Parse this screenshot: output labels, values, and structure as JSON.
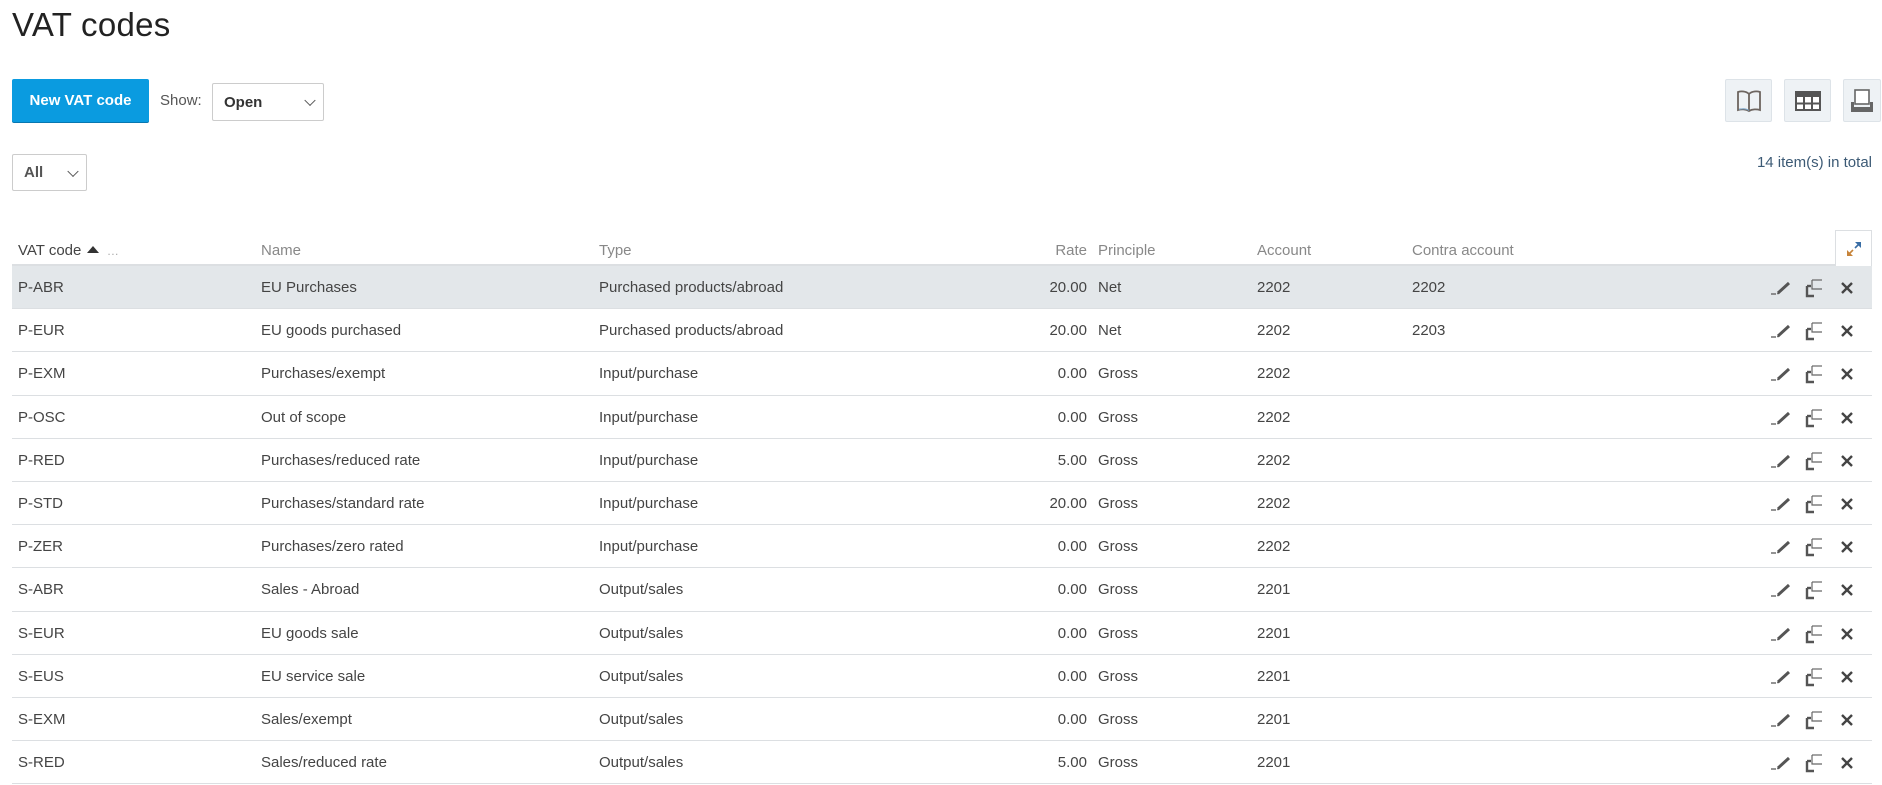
{
  "page": {
    "title": "VAT codes"
  },
  "toolbar": {
    "new_button_label": "New VAT code",
    "show_label": "Show:",
    "show_selected": "Open",
    "filter_selected": "All",
    "total_text": "14 item(s) in total",
    "icons": [
      "book-icon",
      "table-icon",
      "print-icon"
    ]
  },
  "table": {
    "columns": {
      "code": "VAT code",
      "name": "Name",
      "type": "Type",
      "rate": "Rate",
      "principle": "Principle",
      "account": "Account",
      "contra": "Contra account"
    },
    "sort": {
      "column": "VAT code",
      "direction": "ascending"
    },
    "more_indicator": "...",
    "rows": [
      {
        "code": "P-ABR",
        "name": "EU Purchases",
        "type": "Purchased products/abroad",
        "rate": "20.00",
        "principle": "Net",
        "account": "2202",
        "contra": "2202"
      },
      {
        "code": "P-EUR",
        "name": "EU goods purchased",
        "type": "Purchased products/abroad",
        "rate": "20.00",
        "principle": "Net",
        "account": "2202",
        "contra": "2203"
      },
      {
        "code": "P-EXM",
        "name": "Purchases/exempt",
        "type": "Input/purchase",
        "rate": "0.00",
        "principle": "Gross",
        "account": "2202",
        "contra": ""
      },
      {
        "code": "P-OSC",
        "name": "Out of scope",
        "type": "Input/purchase",
        "rate": "0.00",
        "principle": "Gross",
        "account": "2202",
        "contra": ""
      },
      {
        "code": "P-RED",
        "name": "Purchases/reduced rate",
        "type": "Input/purchase",
        "rate": "5.00",
        "principle": "Gross",
        "account": "2202",
        "contra": ""
      },
      {
        "code": "P-STD",
        "name": "Purchases/standard rate",
        "type": "Input/purchase",
        "rate": "20.00",
        "principle": "Gross",
        "account": "2202",
        "contra": ""
      },
      {
        "code": "P-ZER",
        "name": "Purchases/zero rated",
        "type": "Input/purchase",
        "rate": "0.00",
        "principle": "Gross",
        "account": "2202",
        "contra": ""
      },
      {
        "code": "S-ABR",
        "name": "Sales - Abroad",
        "type": "Output/sales",
        "rate": "0.00",
        "principle": "Gross",
        "account": "2201",
        "contra": ""
      },
      {
        "code": "S-EUR",
        "name": "EU goods sale",
        "type": "Output/sales",
        "rate": "0.00",
        "principle": "Gross",
        "account": "2201",
        "contra": ""
      },
      {
        "code": "S-EUS",
        "name": "EU service sale",
        "type": "Output/sales",
        "rate": "0.00",
        "principle": "Gross",
        "account": "2201",
        "contra": ""
      },
      {
        "code": "S-EXM",
        "name": "Sales/exempt",
        "type": "Output/sales",
        "rate": "0.00",
        "principle": "Gross",
        "account": "2201",
        "contra": ""
      },
      {
        "code": "S-RED",
        "name": "Sales/reduced rate",
        "type": "Output/sales",
        "rate": "5.00",
        "principle": "Gross",
        "account": "2201",
        "contra": ""
      }
    ],
    "highlighted_row": 0,
    "row_actions": [
      "edit-icon",
      "copy-icon",
      "delete-icon"
    ]
  },
  "colors": {
    "primary": "#0a9be0",
    "row_highlight": "#e3e7ea",
    "total_text": "#3c5a75"
  }
}
